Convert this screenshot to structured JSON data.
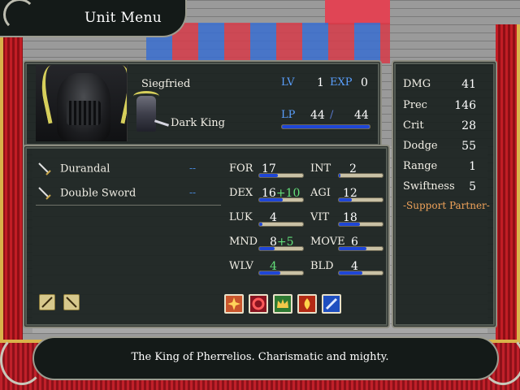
{
  "menu": {
    "title": "Unit Menu"
  },
  "unit": {
    "name": "Siegfried",
    "class": "Dark King",
    "level_label": "LV",
    "level": "1",
    "exp_label": "EXP",
    "exp": "0",
    "lp_label": "LP",
    "lp_current": "44",
    "lp_separator": "/",
    "lp_max": "44",
    "lp_fraction": 1.0
  },
  "weapons": [
    {
      "name": "Durandal",
      "uses": "--",
      "icon": "sword-icon"
    },
    {
      "name": "Double Sword",
      "uses": "--",
      "icon": "sword-icon"
    }
  ],
  "stats": [
    {
      "label": "FOR",
      "value": "17",
      "bonus": "",
      "fill": 0.45
    },
    {
      "label": "INT",
      "value": "2",
      "bonus": "",
      "fill": 0.08
    },
    {
      "label": "DEX",
      "value": "16",
      "bonus": "+10",
      "fill": 0.55
    },
    {
      "label": "AGI",
      "value": "12",
      "bonus": "",
      "fill": 0.32
    },
    {
      "label": "LUK",
      "value": "4",
      "bonus": "",
      "fill": 0.1
    },
    {
      "label": "VIT",
      "value": "18",
      "bonus": "",
      "fill": 0.5
    },
    {
      "label": "MND",
      "value": "8",
      "bonus": "+5",
      "fill": 0.38
    },
    {
      "label": "MOVE",
      "value": "6",
      "bonus": "",
      "fill": 0.65
    },
    {
      "label": "WLV",
      "value": "4",
      "bonus": "",
      "fill": 0.5
    },
    {
      "label": "BLD",
      "value": "4",
      "bonus": "",
      "fill": 0.55
    }
  ],
  "combat": [
    {
      "label": "DMG",
      "value": "41"
    },
    {
      "label": "Prec",
      "value": "146"
    },
    {
      "label": "Crit",
      "value": "28"
    },
    {
      "label": "Dodge",
      "value": "55"
    },
    {
      "label": "Range",
      "value": "1"
    },
    {
      "label": "Swiftness",
      "value": "5"
    }
  ],
  "support_label": "-Support Partner-",
  "items": [
    {
      "icon": "sword-item-icon"
    },
    {
      "icon": "spear-item-icon"
    }
  ],
  "skills": [
    {
      "icon": "starburst-skill-icon",
      "color": "#e35a2a"
    },
    {
      "icon": "ring-skill-icon",
      "color": "#c41c2c"
    },
    {
      "icon": "crown-skill-icon",
      "color": "#3f9a3a"
    },
    {
      "icon": "flame-skill-icon",
      "color": "#d33a1a"
    },
    {
      "icon": "slash-skill-icon",
      "color": "#2a63d8"
    }
  ],
  "description": "The King of Pherrelios. Charismatic and mighty.",
  "colors": {
    "accent_blue": "#5aa0ff",
    "bonus_green": "#64e07a",
    "support_orange": "#f0a35a",
    "bar_fill": "#1f46d6"
  }
}
